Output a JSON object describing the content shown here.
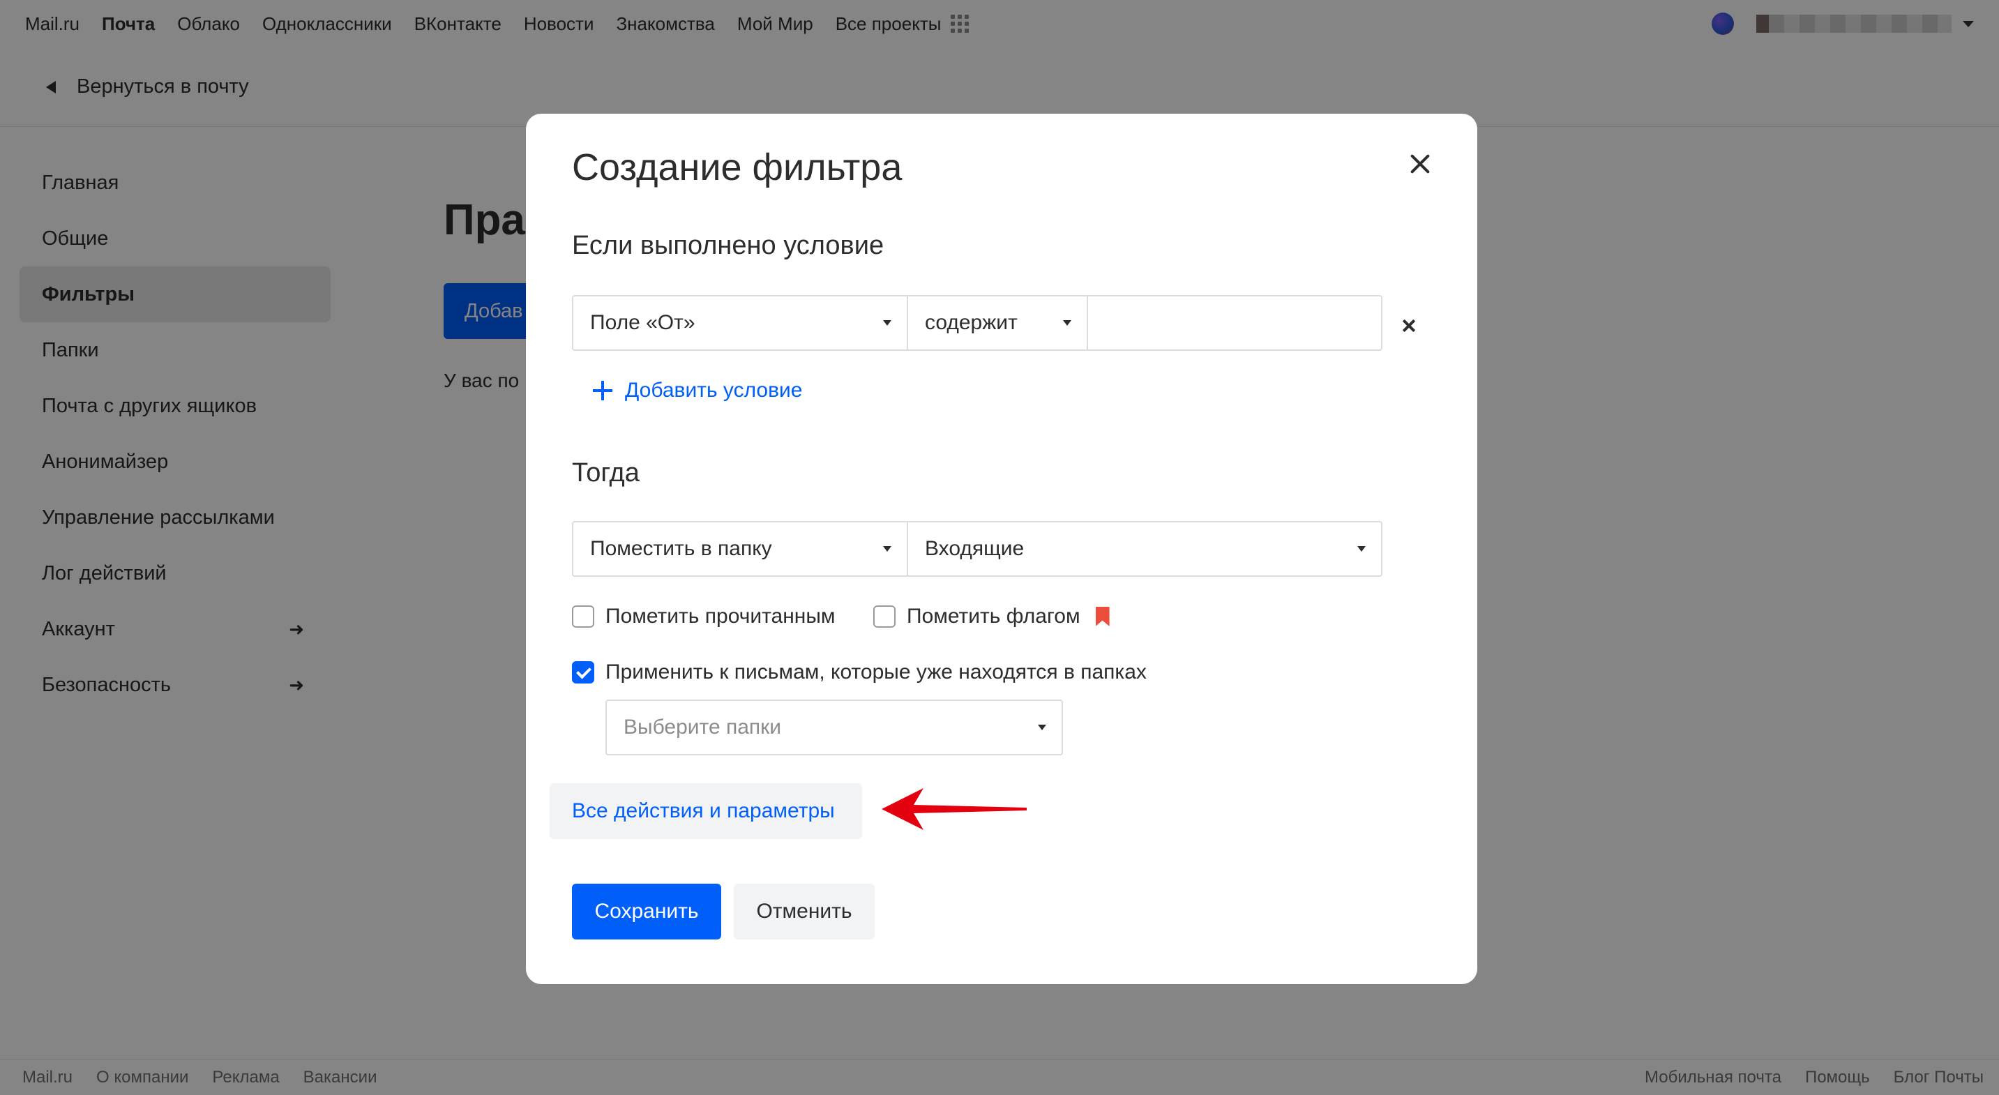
{
  "topnav": {
    "links": [
      "Mail.ru",
      "Почта",
      "Облако",
      "Одноклассники",
      "ВКонтакте",
      "Новости",
      "Знакомства",
      "Мой Мир",
      "Все проекты"
    ],
    "active": "Почта"
  },
  "backbar": {
    "label": "Вернуться в почту"
  },
  "sidebar": {
    "items": [
      {
        "label": "Главная"
      },
      {
        "label": "Общие"
      },
      {
        "label": "Фильтры"
      },
      {
        "label": "Папки"
      },
      {
        "label": "Почта с других ящиков"
      },
      {
        "label": "Анонимайзер"
      },
      {
        "label": "Управление рассылками"
      },
      {
        "label": "Лог действий"
      },
      {
        "label": "Аккаунт",
        "arrow": "➜"
      },
      {
        "label": "Безопасность",
        "arrow": "➜"
      }
    ],
    "active": "Фильтры"
  },
  "main": {
    "title": "Пра",
    "add_button": "Добав",
    "note": "У вас по"
  },
  "modal": {
    "title": "Создание фильтра",
    "condition_heading": "Если выполнено условие",
    "condition": {
      "field": "Поле «От»",
      "operator": "содержит",
      "value": ""
    },
    "add_condition": "Добавить условие",
    "then_heading": "Тогда",
    "action": {
      "type": "Поместить в папку",
      "folder": "Входящие"
    },
    "mark_read": {
      "label": "Пометить прочитанным",
      "checked": false
    },
    "mark_flag": {
      "label": "Пометить флагом",
      "checked": false
    },
    "apply_existing": {
      "label": "Применить к письмам, которые уже находятся в папках",
      "checked": true
    },
    "folders_placeholder": "Выберите папки",
    "all_actions": "Все действия и параметры",
    "save": "Сохранить",
    "cancel": "Отменить"
  },
  "footer": {
    "left": [
      "Mail.ru",
      "О компании",
      "Реклама",
      "Вакансии"
    ],
    "right": [
      "Мобильная почта",
      "Помощь",
      "Блог Почты"
    ]
  },
  "colors": {
    "accent": "#005ff9",
    "flag": "#ed4d3c",
    "annotation_arrow": "#e3000f"
  }
}
